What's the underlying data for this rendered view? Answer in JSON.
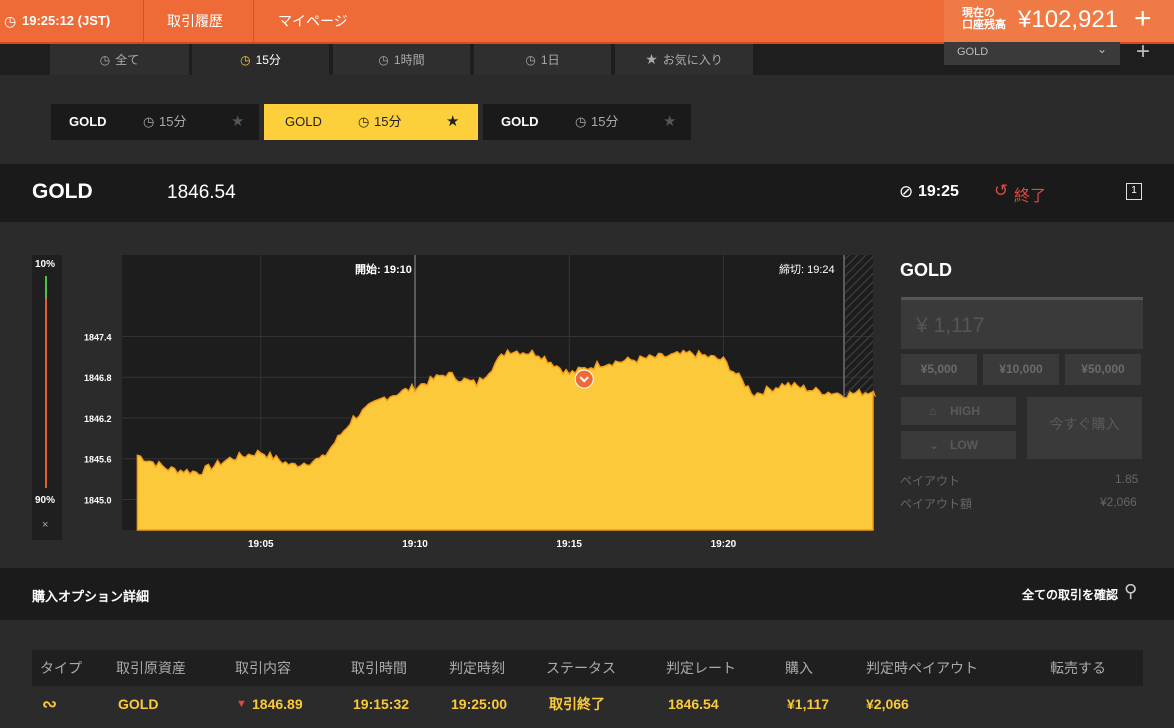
{
  "topbar": {
    "time": "19:25:12 (JST)",
    "nav_history": "取引履歴",
    "nav_mypage": "マイページ",
    "balance_label_1": "現在の",
    "balance_label_2": "口座残高",
    "balance_value": "¥102,921",
    "plus": "+"
  },
  "tabs": [
    {
      "label": "全て",
      "icon": "clock-icon",
      "active": false
    },
    {
      "label": "15分",
      "icon": "clock-icon",
      "active": true
    },
    {
      "label": "1時間",
      "icon": "clock-icon",
      "active": false
    },
    {
      "label": "1日",
      "icon": "clock-icon",
      "active": false
    },
    {
      "label": "お気に入り",
      "icon": "star-icon",
      "active": false
    }
  ],
  "asset_select": {
    "value": "GOLD"
  },
  "chips": [
    {
      "asset": "GOLD",
      "period": "15分"
    },
    {
      "asset": "GOLD",
      "period": "15分"
    },
    {
      "asset": "GOLD",
      "period": "15分"
    }
  ],
  "assetbar": {
    "asset": "GOLD",
    "price": "1846.54",
    "expiry": "19:25",
    "status": "終了",
    "window_icon_label": "1"
  },
  "side_labels": {
    "top": "10%",
    "bottom": "90%",
    "close": "×"
  },
  "chart_data": {
    "type": "area",
    "x_ticks": [
      "19:05",
      "19:10",
      "19:15",
      "19:20"
    ],
    "y_ticks": [
      "1847.4",
      "1846.8",
      "1846.2",
      "1845.6",
      "1845.0"
    ],
    "ylim": [
      1844.55,
      1848.6
    ],
    "start_label": "開始: 19:10",
    "close_label": "締切: 19:24",
    "entry_rate": 1846.89,
    "series_color": "#fcc93a",
    "x": [
      "19:01",
      "19:02",
      "19:03",
      "19:04",
      "19:05",
      "19:06",
      "19:07",
      "19:08",
      "19:09",
      "19:10",
      "19:11",
      "19:12",
      "19:13",
      "19:14",
      "19:15",
      "19:16",
      "19:17",
      "19:18",
      "19:19",
      "19:20",
      "19:21",
      "19:22",
      "19:23",
      "19:24",
      "19:25"
    ],
    "values": [
      1845.65,
      1845.45,
      1845.4,
      1845.6,
      1845.7,
      1845.5,
      1845.6,
      1846.2,
      1846.5,
      1846.65,
      1846.85,
      1846.7,
      1847.2,
      1847.15,
      1846.85,
      1847.0,
      1847.05,
      1847.1,
      1847.15,
      1847.05,
      1846.55,
      1846.7,
      1846.6,
      1846.55,
      1846.6
    ]
  },
  "panel": {
    "asset": "GOLD",
    "amount_placeholder": "¥ 1,117",
    "amounts": [
      "¥5,000",
      "¥10,000",
      "¥50,000"
    ],
    "high": "HIGH",
    "low": "LOW",
    "buy_now": "今すぐ購入",
    "payout_label": "ペイアウト",
    "payout_value": "1.85",
    "payout_amount_label": "ペイアウト額",
    "payout_amount_value": "¥2,066"
  },
  "details": {
    "title": "購入オプション詳細",
    "view_all": "全ての取引を確認",
    "headers": [
      "タイプ",
      "取引原資産",
      "取引内容",
      "取引時間",
      "判定時刻",
      "ステータス",
      "判定レート",
      "購入",
      "判定時ペイアウト",
      "転売する"
    ],
    "row": {
      "asset": "GOLD",
      "content": "1846.89",
      "trade_time": "19:15:32",
      "judge_time": "19:25:00",
      "status": "取引終了",
      "judge_rate": "1846.54",
      "purchase": "¥1,117",
      "payout": "¥2,066"
    }
  }
}
